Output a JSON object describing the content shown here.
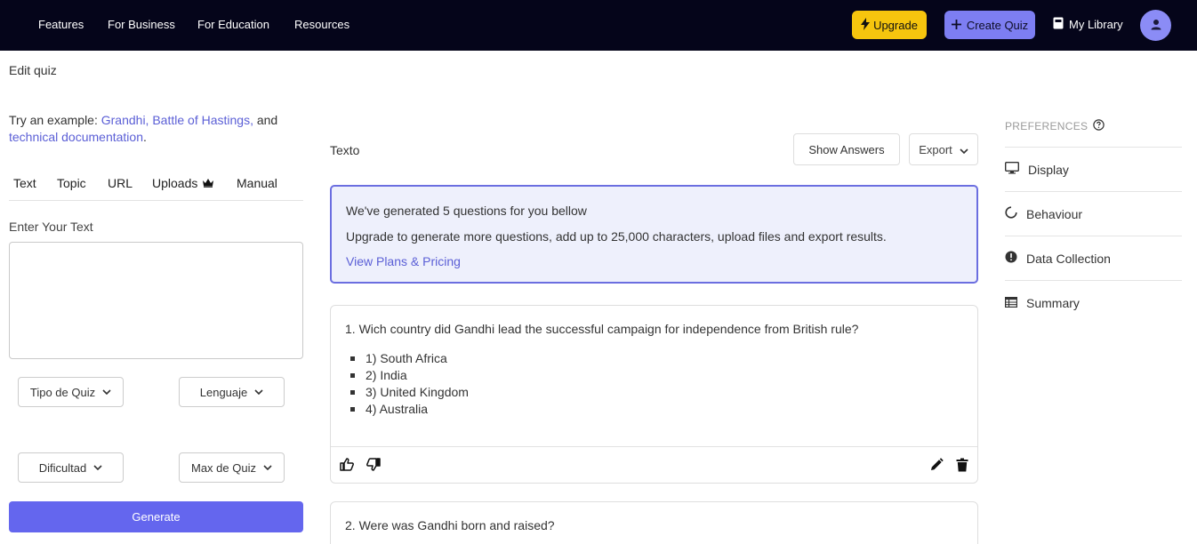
{
  "nav": {
    "links": [
      "Features",
      "For Business",
      "For Education",
      "Resources"
    ],
    "upgrade_label": "Upgrade",
    "create_quiz_label": "Create Quiz",
    "my_library_label": "My Library"
  },
  "left": {
    "edit_quiz": "Edit quiz",
    "try_prefix": "Try an example:",
    "example_1": "Grandhi,",
    "example_2": "Battle of Hastings,",
    "example_and": "and",
    "example_3": "technical documentation",
    "example_end": ".",
    "tabs": [
      "Text",
      "Topic",
      "URL",
      "Uploads",
      "Manual"
    ],
    "enter_text_label": "Enter Your Text",
    "textarea_value": "",
    "selects": [
      "Tipo de Quiz",
      "Lenguaje",
      "Dificultad",
      "Max de Quiz"
    ],
    "generate_label": "Generate"
  },
  "center": {
    "title": "Texto",
    "show_answers_label": "Show Answers",
    "export_label": "Export",
    "notice": {
      "line1": "We've generated 5 questions for you bellow",
      "line2": "Upgrade to generate more questions, add up to 25,000 characters, upload files and export results.",
      "link": "View Plans & Pricing"
    },
    "questions": [
      {
        "text": "1. Wich country did Gandhi lead the successful campaign for independence from British rule?",
        "options": [
          "1) South Africa",
          "2) India",
          "3) United Kingdom",
          "4) Australia"
        ]
      },
      {
        "text": "2. Were was Gandhi born and raised?",
        "options": []
      }
    ]
  },
  "right": {
    "preferences_title": "PREFERENCES",
    "items": [
      "Display",
      "Behaviour",
      "Data Collection",
      "Summary"
    ]
  },
  "colors": {
    "nav_bg": "#05051a",
    "upgrade": "#f6c50e",
    "create_quiz": "#7d7ef2",
    "accent": "#6466ee",
    "link": "#5b5fd6"
  }
}
